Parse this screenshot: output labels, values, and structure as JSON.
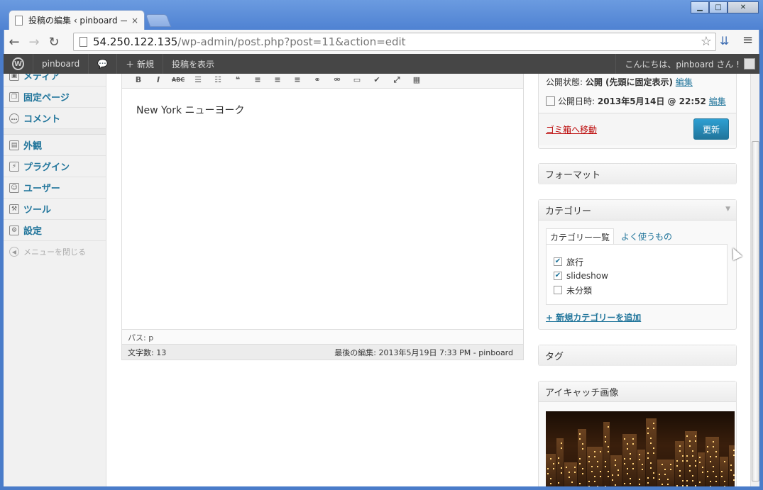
{
  "browser": {
    "tab_title": "投稿の編集 ‹ pinboard —",
    "tab_close": "×",
    "url_host": "54.250.122.135",
    "url_path": "/wp-admin/post.php?post=11&action=edit",
    "back": "←",
    "forward": "→",
    "reload": "↻",
    "star": "☆",
    "menu": "≡",
    "win_minimize": "▁",
    "win_maximize": "□",
    "win_close": "✕"
  },
  "adminbar": {
    "logo": "W",
    "site_name": "pinboard",
    "comments_icon": "💬",
    "new_label": "＋ 新規",
    "view_post": "投稿を表示",
    "greeting": "こんにちは、pinboard さん !"
  },
  "sidebar": {
    "items_top": [
      {
        "label": "メディア",
        "icon": "media-icon"
      },
      {
        "label": "固定ページ",
        "icon": "pages-icon"
      },
      {
        "label": "コメント",
        "icon": "comments-icon"
      }
    ],
    "items_bottom": [
      {
        "label": "外観",
        "icon": "appearance-icon"
      },
      {
        "label": "プラグイン",
        "icon": "plugins-icon"
      },
      {
        "label": "ユーザー",
        "icon": "users-icon"
      },
      {
        "label": "ツール",
        "icon": "tools-icon"
      },
      {
        "label": "設定",
        "icon": "settings-icon"
      }
    ],
    "collapse": "メニューを閉じる"
  },
  "editor": {
    "toolbar_icons": [
      "bold-icon",
      "italic-icon",
      "strikethrough-icon",
      "bullet-list-icon",
      "numbered-list-icon",
      "blockquote-icon",
      "align-left-icon",
      "align-center-icon",
      "align-right-icon",
      "link-icon",
      "unlink-icon",
      "more-tag-icon",
      "spellcheck-icon",
      "fullscreen-icon",
      "kitchen-sink-icon"
    ],
    "toolbar_glyphs": [
      "B",
      "I",
      "ABC",
      "☰",
      "☷",
      "❝",
      "≡",
      "≡",
      "≡",
      "⚭",
      "⚮",
      "▭",
      "✔",
      "⤢",
      "▦"
    ],
    "content": "New York ニューヨーク",
    "path": "パス: p",
    "word_count": "文字数: 13",
    "last_edited": "最後の編集: 2013年5月19日 7:33 PM - pinboard"
  },
  "publish": {
    "status_label": "公開状態:",
    "status_value": "公開 (先頭に固定表示)",
    "edit": "編集",
    "date_label": "公開日時:",
    "date_value": "2013年5月14日 @ 22:52",
    "trash": "ゴミ箱へ移動",
    "update": "更新"
  },
  "format_box": {
    "title": "フォーマット"
  },
  "categories": {
    "title": "カテゴリー",
    "tab_all": "カテゴリー一覧",
    "tab_popular": "よく使うもの",
    "items": [
      {
        "label": "旅行",
        "checked": "✔"
      },
      {
        "label": "slideshow",
        "checked": "✔"
      },
      {
        "label": "未分類",
        "checked": ""
      }
    ],
    "add_new": "+ 新規カテゴリーを追加"
  },
  "tags_box": {
    "title": "タグ"
  },
  "featured_image": {
    "title": "アイキャッチ画像"
  }
}
